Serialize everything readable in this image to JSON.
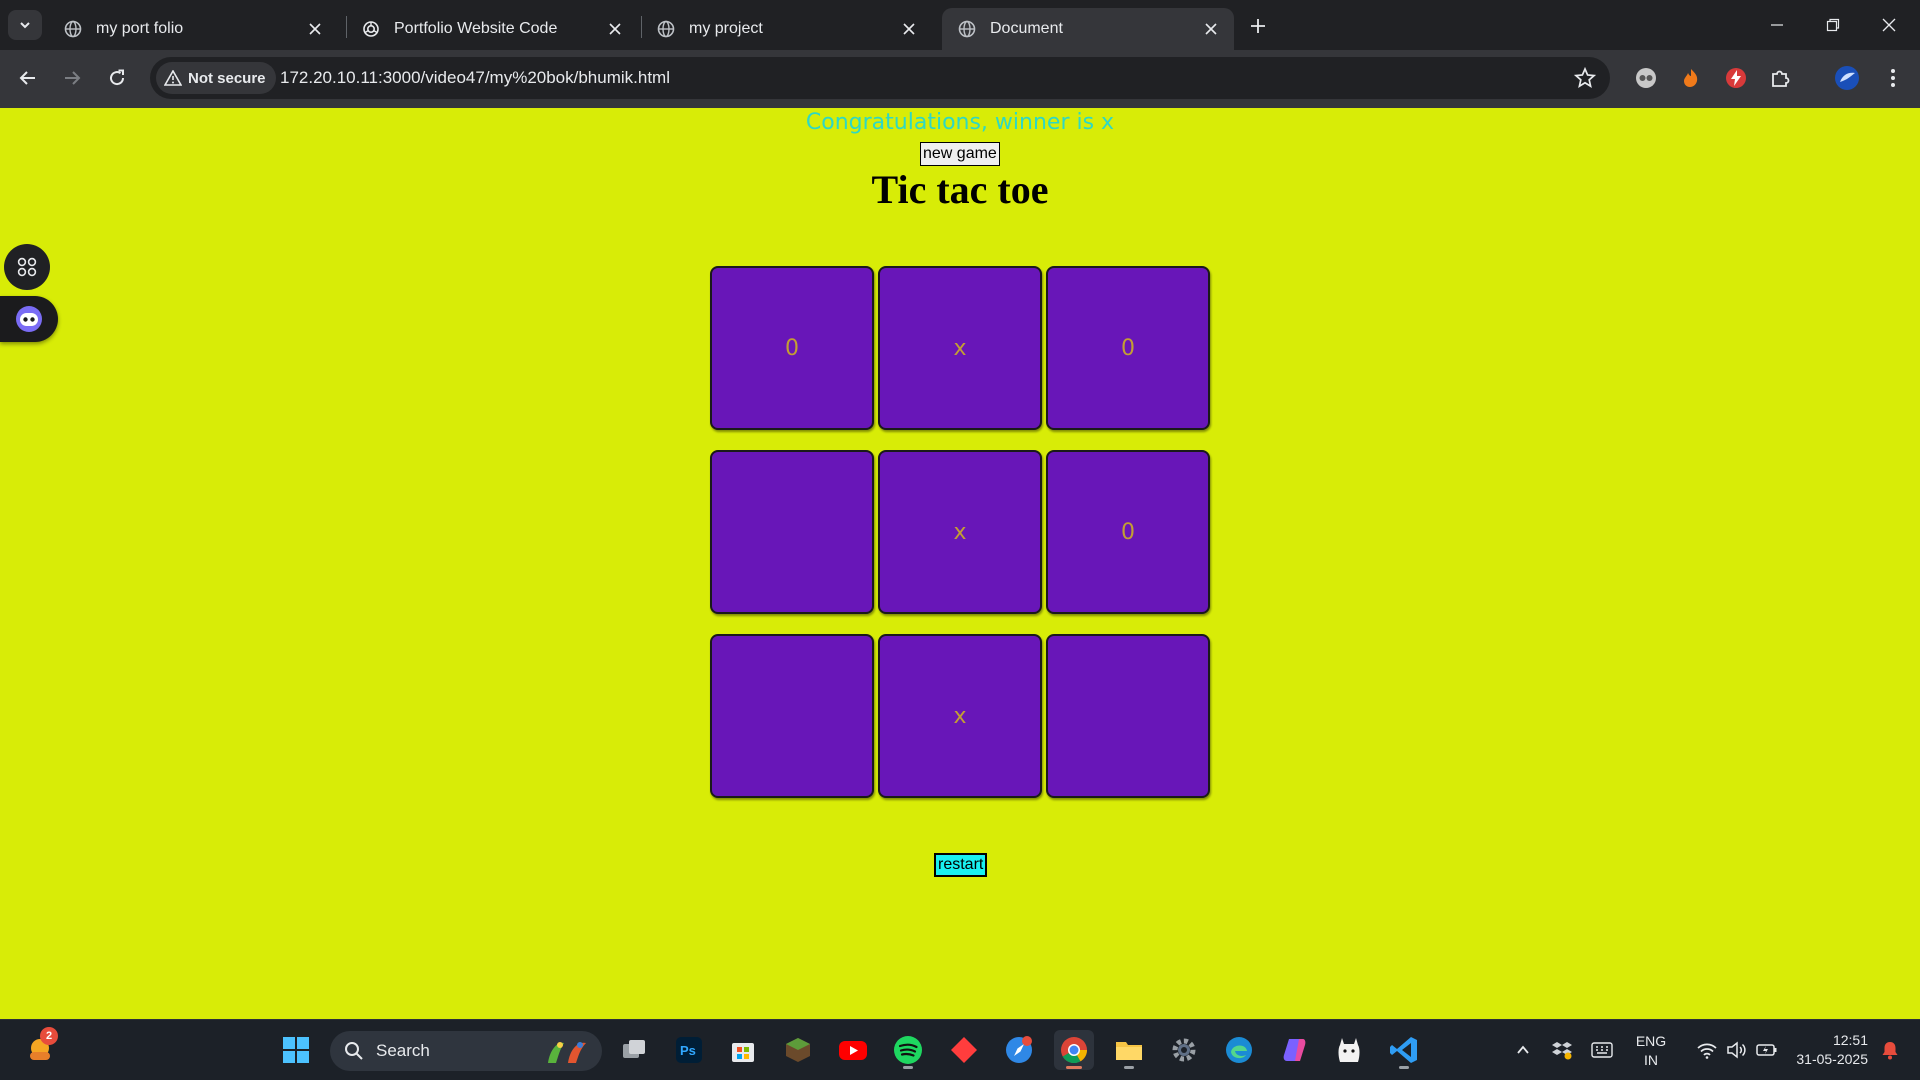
{
  "browser": {
    "tabs": [
      {
        "title": "my port folio",
        "active": false
      },
      {
        "title": "Portfolio Website Code",
        "active": false
      },
      {
        "title": "my project",
        "active": false
      },
      {
        "title": "Document",
        "active": true
      }
    ],
    "security_label": "Not secure",
    "url": "172.20.10.11:3000/video47/my%20bok/bhumik.html"
  },
  "game": {
    "message": "Congratulations, winner is x",
    "new_game_label": "new game",
    "title": "Tic tac toe",
    "cells": [
      "0",
      "x",
      "0",
      "",
      "x",
      "0",
      "",
      "x",
      ""
    ],
    "restart_label": "restart",
    "colors": {
      "page_bg": "#d8ec07",
      "cell_bg": "#6816b8",
      "cell_text": "#c39e34",
      "message": "#2ed8c4",
      "restart_bg": "#19f0f0"
    }
  },
  "taskbar": {
    "search_label": "Search",
    "widget_badge": "2",
    "language_line1": "ENG",
    "language_line2": "IN",
    "time": "12:51",
    "date": "31-05-2025"
  }
}
